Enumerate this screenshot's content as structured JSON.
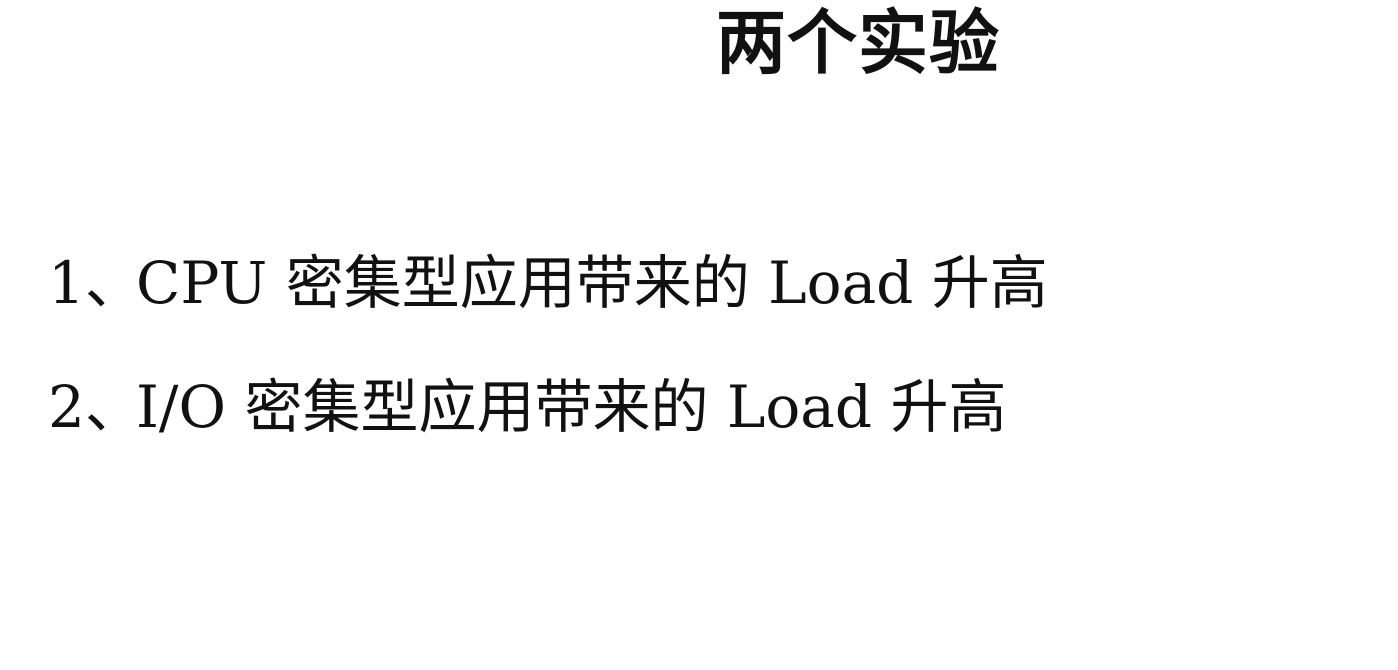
{
  "slide": {
    "title": "两个实验",
    "items": [
      {
        "number": "1、",
        "text": "CPU 密集型应用带来的 Load 升高"
      },
      {
        "number": "2、",
        "text": "I/O 密集型应用带来的 Load 升高"
      }
    ]
  }
}
